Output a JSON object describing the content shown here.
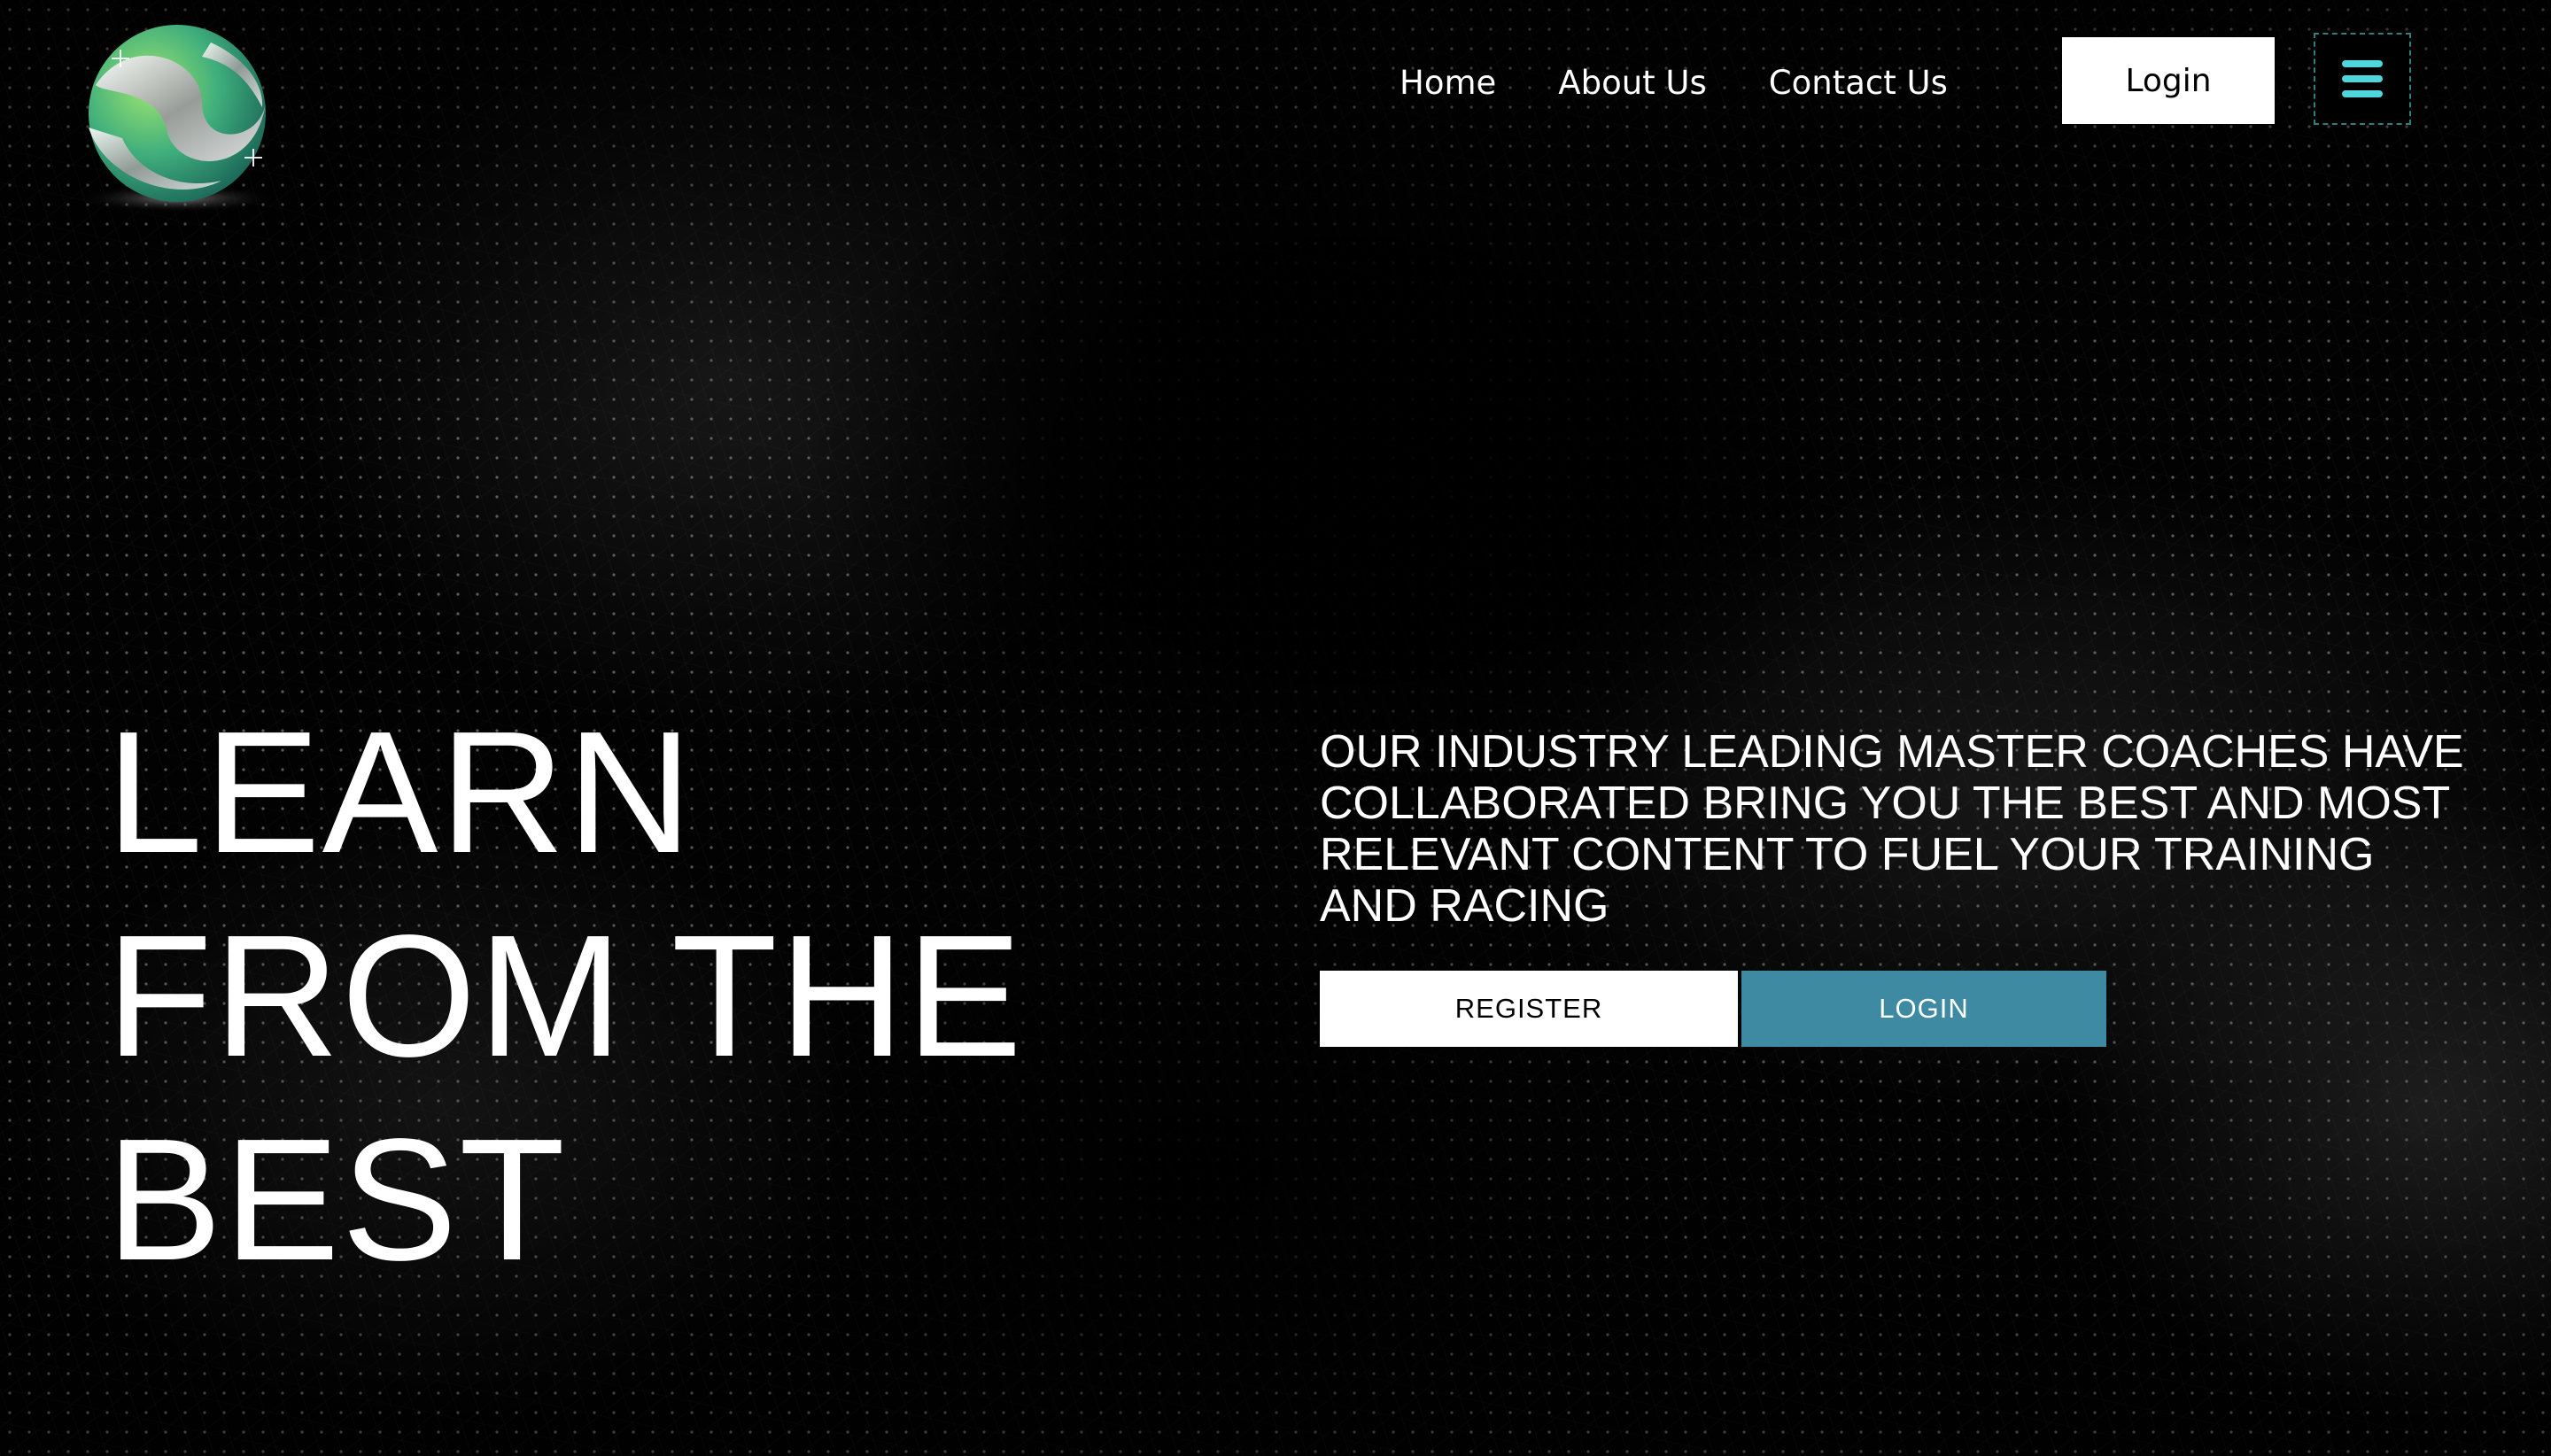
{
  "nav": {
    "items": [
      "Home",
      "About Us",
      "Contact Us"
    ],
    "login_label": "Login",
    "menu_icon": "hamburger-menu-icon"
  },
  "logo": {
    "icon": "sphere-logo-icon",
    "colors": [
      "#2f9e7a",
      "#8fd66a",
      "#c0c0c0"
    ]
  },
  "hero": {
    "headline": "LEARN FROM THE BEST",
    "tagline": "OUR INDUSTRY LEADING MASTER COACHES HAVE COLLABORATED BRING YOU THE BEST AND MOST RELEVANT CONTENT TO FUEL YOUR TRAINING AND RACING",
    "register_label": "REGISTER",
    "login_label": "LOGIN"
  },
  "colors": {
    "accent": "#3f8aa3",
    "menu_icon": "#4fd6da",
    "background": "#000000"
  }
}
